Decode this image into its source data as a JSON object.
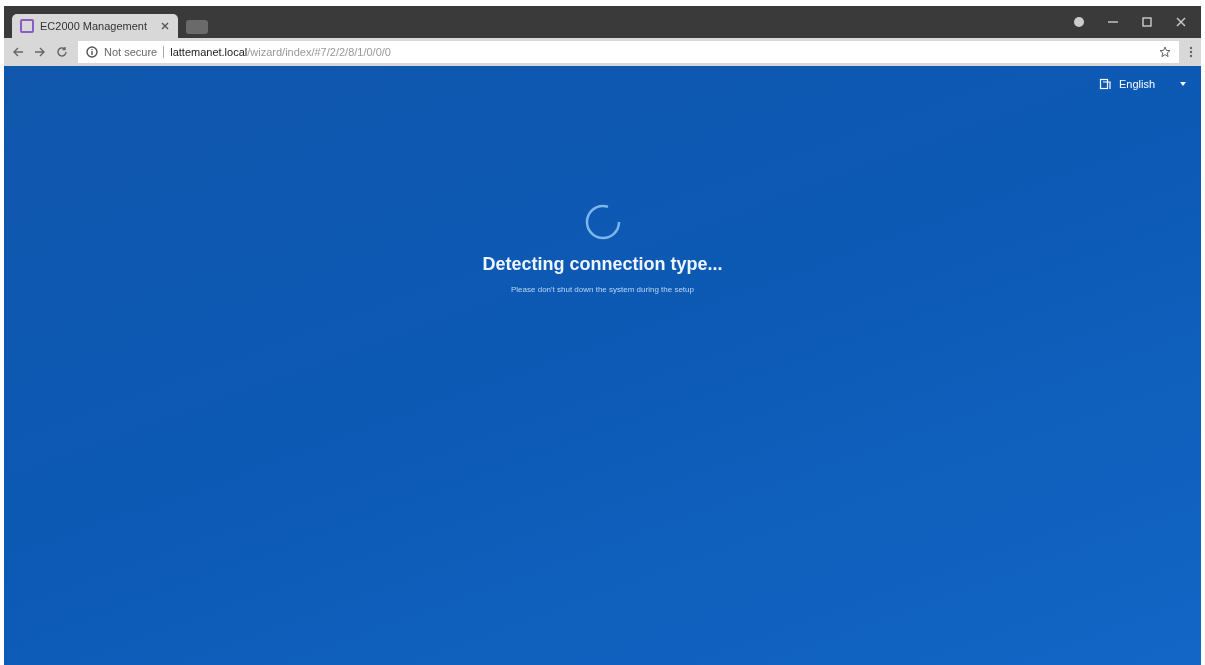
{
  "browser": {
    "tabs": [
      {
        "title": "EC2000 Management",
        "selected": true
      },
      {
        "selected": false
      }
    ],
    "address": {
      "security": "Not secure",
      "host": "lattemanet.local",
      "path": "/wizard/index/#7/2/2/8/1/0/0/0"
    }
  },
  "page": {
    "language": "English",
    "title": "Detecting connection type...",
    "subtitle": "Please don't shut down the system during the setup"
  }
}
